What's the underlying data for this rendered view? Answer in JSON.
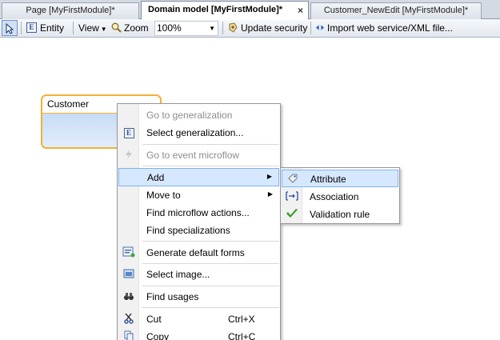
{
  "tabs": [
    {
      "label": "Page [MyFirstModule]*"
    },
    {
      "label": "Domain model [MyFirstModule]*",
      "close": "×"
    },
    {
      "label": "Customer_NewEdit [MyFirstModule]*"
    }
  ],
  "toolbar": {
    "entity_label": "Entity",
    "view_label": "View",
    "zoom_label": "Zoom",
    "zoom_value": "100%",
    "update_security_label": "Update security",
    "import_label": "Import web service/XML file..."
  },
  "entity": {
    "name": "Customer"
  },
  "context_menu": {
    "items": [
      {
        "label": "Go to generalization",
        "disabled": true
      },
      {
        "label": "Select generalization..."
      },
      {
        "label": "Go to event microflow",
        "disabled": true
      },
      {
        "label": "Add",
        "highlighted": true,
        "submenu_arrow": "▶"
      },
      {
        "label": "Move to",
        "submenu_arrow": "▶"
      },
      {
        "label": "Find microflow actions..."
      },
      {
        "label": "Find specializations"
      },
      {
        "label": "Generate default forms"
      },
      {
        "label": "Select image..."
      },
      {
        "label": "Find usages"
      },
      {
        "label": "Cut",
        "shortcut": "Ctrl+X"
      },
      {
        "label": "Copy",
        "shortcut": "Ctrl+C"
      }
    ]
  },
  "submenu": {
    "items": [
      {
        "label": "Attribute",
        "highlighted": true
      },
      {
        "label": "Association"
      },
      {
        "label": "Validation rule"
      }
    ]
  },
  "colors": {
    "entity_border": "#f2b132",
    "highlight_bg": "#d6e8ff",
    "highlight_border": "#7fb2f0",
    "validation_check": "#3c9a2b"
  }
}
